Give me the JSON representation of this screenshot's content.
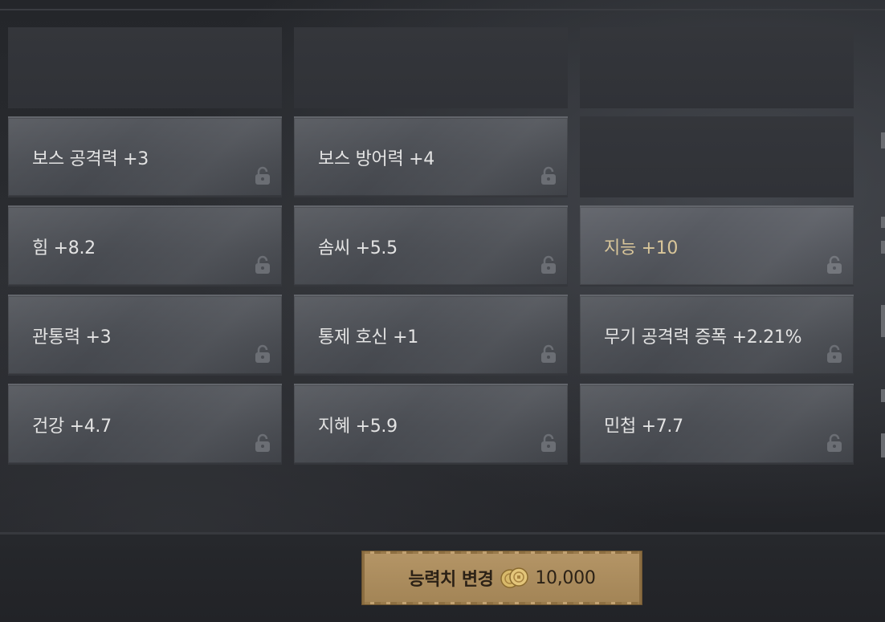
{
  "stats": {
    "row1": {
      "col1": "보스 공격력 +3",
      "col2": "보스 방어력 +4"
    },
    "row2": {
      "col1": "힘 +8.2",
      "col2": "솜씨 +5.5",
      "col3": "지능 +10"
    },
    "row3": {
      "col1": "관통력 +3",
      "col2": "통제 호신 +1",
      "col3": "무기 공격력 증폭 +2.21%"
    },
    "row4": {
      "col1": "건강 +4.7",
      "col2": "지혜 +5.9",
      "col3": "민첩 +7.7"
    }
  },
  "colors": {
    "highlight_text": "#d9c69a",
    "normal_text": "#e3e3e3",
    "button_bg": "#b08f5d"
  },
  "icons": {
    "lock": "unlock-icon",
    "coin": "gold-coin-icon"
  },
  "change_button": {
    "label": "능력치 변경",
    "cost": "10,000"
  }
}
